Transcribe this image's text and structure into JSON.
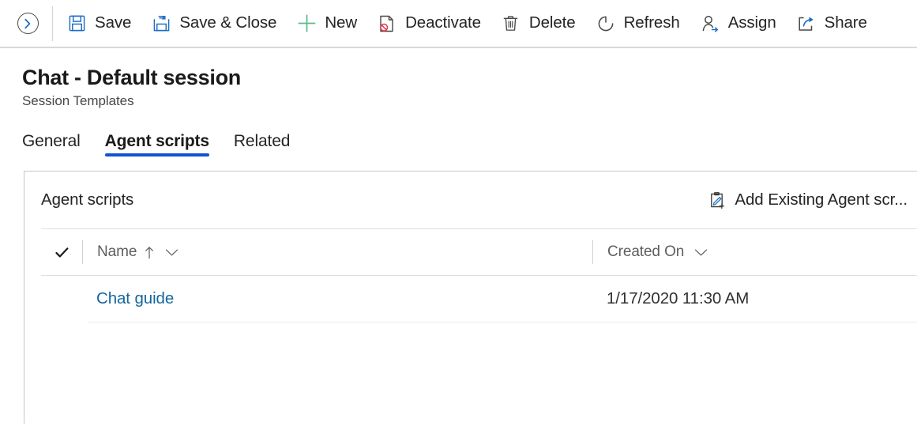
{
  "commandbar": {
    "nav_expand_tooltip": "Expand",
    "buttons": [
      {
        "label": "Save",
        "icon": "save-icon"
      },
      {
        "label": "Save & Close",
        "icon": "save-and-close-icon"
      },
      {
        "label": "New",
        "icon": "plus-icon"
      },
      {
        "label": "Deactivate",
        "icon": "deactivate-icon"
      },
      {
        "label": "Delete",
        "icon": "trash-icon"
      },
      {
        "label": "Refresh",
        "icon": "refresh-icon"
      },
      {
        "label": "Assign",
        "icon": "assign-user-icon"
      },
      {
        "label": "Share",
        "icon": "share-icon"
      }
    ]
  },
  "header": {
    "title": "Chat - Default session",
    "subtitle": "Session Templates"
  },
  "tabs": [
    {
      "label": "General",
      "active": false
    },
    {
      "label": "Agent scripts",
      "active": true
    },
    {
      "label": "Related",
      "active": false
    }
  ],
  "subgrid": {
    "title": "Agent scripts",
    "add_existing_label": "Add Existing Agent scr...",
    "add_existing_icon": "add-existing-clipboard-icon",
    "columns": [
      {
        "label": "Name",
        "sort": "ascending",
        "sort_icon": "arrow-up-icon",
        "menu_icon": "chevron-down-icon"
      },
      {
        "label": "Created On",
        "sort": "none",
        "menu_icon": "chevron-down-icon"
      }
    ],
    "select_all_icon": "checkmark-icon",
    "rows": [
      {
        "name": "Chat guide",
        "created_on": "1/17/2020 11:30 AM"
      }
    ]
  },
  "colors": {
    "accent": "#0f55d0",
    "link": "#15669e",
    "icon_blue": "#1b6ec2",
    "icon_green": "#5cbb8a",
    "icon_red": "#e0324a",
    "text": "#242424",
    "muted": "#605e5c",
    "border": "#c8c6c4"
  }
}
